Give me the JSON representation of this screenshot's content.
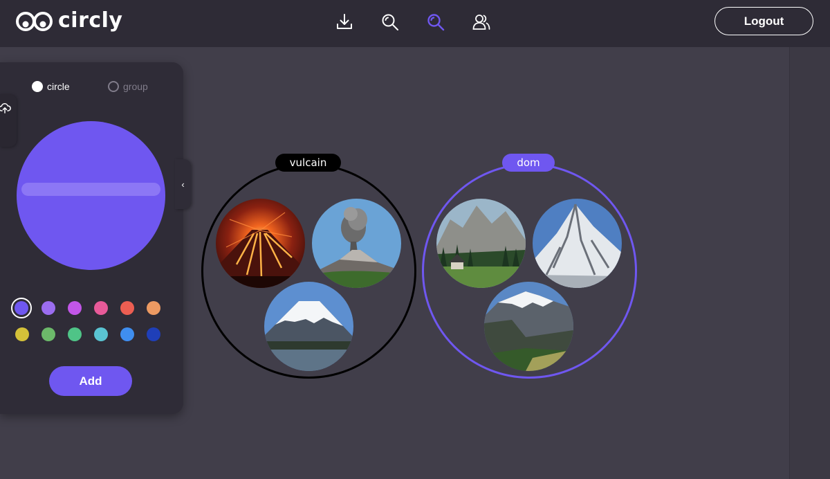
{
  "app": {
    "name": "circly"
  },
  "nav": {
    "items": [
      {
        "icon": "download-icon",
        "active": false
      },
      {
        "icon": "search-icon",
        "active": false
      },
      {
        "icon": "search-icon",
        "active": true
      },
      {
        "icon": "users-icon",
        "active": false
      }
    ],
    "active_color": "#6f57f0",
    "inactive_color": "#ffffff"
  },
  "header": {
    "logout_label": "Logout"
  },
  "panel": {
    "mode_options": [
      {
        "label": "circle",
        "selected": true
      },
      {
        "label": "group",
        "selected": false
      }
    ],
    "preview_color": "#6f57f0",
    "name_input": {
      "value": "",
      "placeholder": ""
    },
    "palette": [
      "#6f57f0",
      "#9b6df0",
      "#c256e8",
      "#e85a99",
      "#ec5e52",
      "#ed9a62",
      "#d4c139",
      "#6cb96a",
      "#4fc487",
      "#5ac4d2",
      "#3f8ef0",
      "#1f3fb8"
    ],
    "selected_color": "#6f57f0",
    "add_label": "Add"
  },
  "circles": [
    {
      "name": "vulcain",
      "outline_color": "#000000",
      "label_bg": "#000000",
      "photos": [
        "erupting-volcano",
        "ash-plume-volcano",
        "snow-capped-volcano"
      ]
    },
    {
      "name": "dom",
      "outline_color": "#6f57f0",
      "label_bg": "#6f57f0",
      "photos": [
        "alpine-valley",
        "snowy-peak",
        "mountain-range"
      ]
    }
  ]
}
